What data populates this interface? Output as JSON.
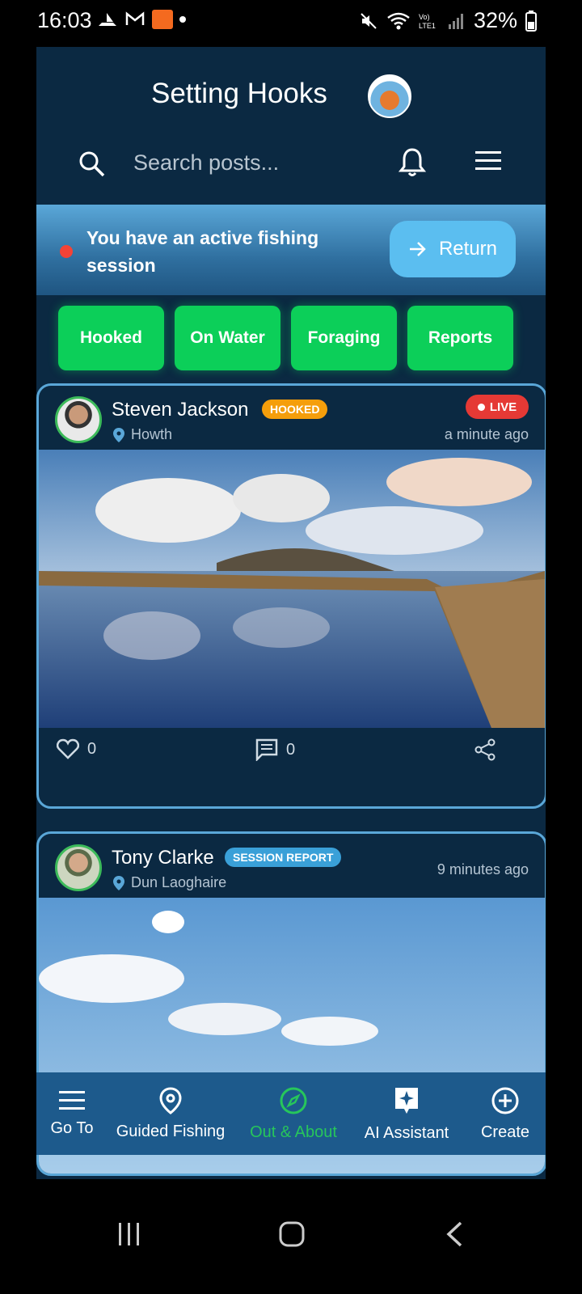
{
  "status_bar": {
    "time": "16:03",
    "battery": "32%"
  },
  "header": {
    "title": "Setting Hooks",
    "search_placeholder": "Search posts..."
  },
  "banner": {
    "text": "You have an active fishing session",
    "return_label": "Return"
  },
  "chips": [
    "Hooked",
    "On Water",
    "Foraging",
    "Reports"
  ],
  "posts": [
    {
      "author": "Steven Jackson",
      "badge": "HOOKED",
      "badge_color": "#f59e0b",
      "location": "Howth",
      "live_label": "LIVE",
      "time": "a minute ago",
      "likes": "0",
      "comments": "0"
    },
    {
      "author": "Tony Clarke",
      "badge": "SESSION REPORT",
      "badge_color": "#3aa0d8",
      "location": "Dun Laoghaire",
      "time": "9 minutes ago"
    }
  ],
  "nav": {
    "items": [
      "Go To",
      "Guided Fishing",
      "Out & About",
      "AI Assistant",
      "Create"
    ],
    "active": "Out & About",
    "active_color": "#27c65b"
  }
}
